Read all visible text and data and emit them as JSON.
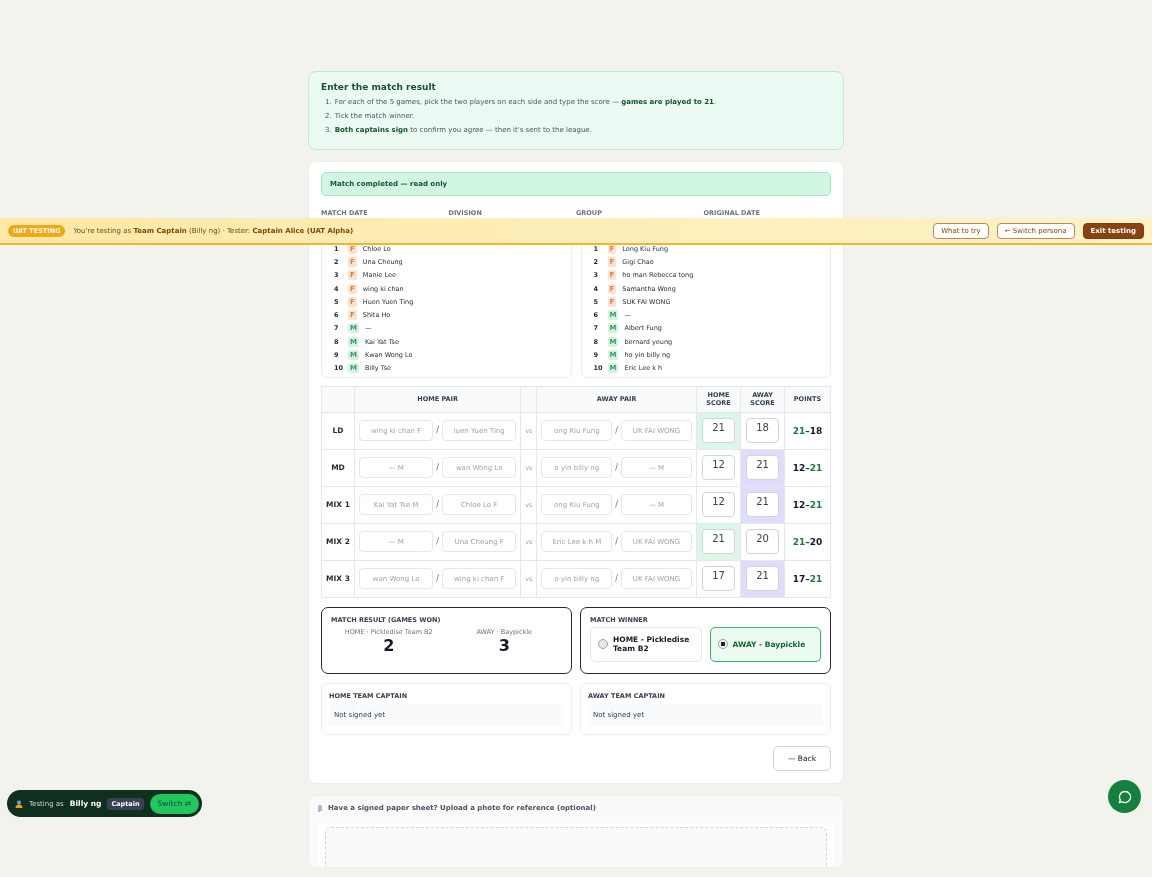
{
  "instructions": {
    "title": "Enter the match result",
    "steps": [
      "For each of the 5 games, pick the two players on each side and type the score — **games are played to 21**.",
      "Tick the match winner.",
      "**Both captains sign** to confirm you agree — then it's sent to the league."
    ],
    "step_numbers": [
      "1.",
      "2.",
      "3."
    ]
  },
  "status": "Match completed — read only",
  "meta_labels": [
    "MATCH DATE",
    "DIVISION",
    "GROUP",
    "ORIGINAL DATE"
  ],
  "testing_banner": {
    "badge": "UAT TESTING",
    "text": "You're testing as **Team Captain** (Billy ng)  · Tester: **Captain Alice (UAT Alpha)**",
    "buttons": [
      {
        "label": "What to try",
        "kind": "outline"
      },
      {
        "label": "← Switch persona",
        "kind": "outline"
      },
      {
        "label": "Exit testing",
        "kind": "solid"
      }
    ]
  },
  "rosters": [
    [
      {
        "num": "1",
        "badge": "F",
        "kind": "female",
        "name": "Chloe Lo"
      },
      {
        "num": "2",
        "badge": "F",
        "kind": "female",
        "name": "Una Cheung"
      },
      {
        "num": "3",
        "badge": "F",
        "kind": "female",
        "name": "Manie Lee"
      },
      {
        "num": "4",
        "badge": "F",
        "kind": "female",
        "name": "wing ki chan"
      },
      {
        "num": "5",
        "badge": "F",
        "kind": "female",
        "name": "Huen Yuen Ting"
      },
      {
        "num": "6",
        "badge": "F",
        "kind": "female",
        "name": "Shita Ho"
      },
      {
        "num": "7",
        "badge": "M",
        "kind": "male",
        "name": "—"
      },
      {
        "num": "8",
        "badge": "M",
        "kind": "male",
        "name": "Kai Yat Tse"
      },
      {
        "num": "9",
        "badge": "M",
        "kind": "male",
        "name": "Kwan Wong Lo"
      },
      {
        "num": "10",
        "badge": "M",
        "kind": "male",
        "name": "Billy Tse"
      }
    ],
    [
      {
        "num": "1",
        "badge": "F",
        "kind": "female",
        "name": "Long Kiu Fung"
      },
      {
        "num": "2",
        "badge": "F",
        "kind": "female",
        "name": "Gigi Chao"
      },
      {
        "num": "3",
        "badge": "F",
        "kind": "female",
        "name": "ho man Rebecca tong"
      },
      {
        "num": "4",
        "badge": "F",
        "kind": "female",
        "name": "Samantha Wong"
      },
      {
        "num": "5",
        "badge": "F",
        "kind": "female",
        "name": "SUK FAI WONG"
      },
      {
        "num": "6",
        "badge": "M",
        "kind": "male",
        "name": "—"
      },
      {
        "num": "7",
        "badge": "M",
        "kind": "male",
        "name": "Albert Fung"
      },
      {
        "num": "8",
        "badge": "M",
        "kind": "male",
        "name": "bernard yeung"
      },
      {
        "num": "9",
        "badge": "M",
        "kind": "male",
        "name": "ho yin billy ng"
      },
      {
        "num": "10",
        "badge": "M",
        "kind": "male",
        "name": "Eric Lee k h"
      }
    ]
  ],
  "games_table": {
    "columns": [
      "HOME PAIR",
      "AWAY PAIR",
      "HOME SCORE",
      "AWAY SCORE",
      "POINTS"
    ],
    "separator": "/",
    "rows": [
      {
        "game": "LD",
        "home": [
          "wing ki chan F",
          "luen Yuen Ting"
        ],
        "away": [
          "ong Kiu Fung",
          "UK FAI WONG"
        ],
        "home_score": "21",
        "away_score": "18",
        "home_won": true,
        "vs": "vs",
        "points": {
          "home": "21",
          "dash": "–",
          "away": "18"
        }
      },
      {
        "game": "MD",
        "home": [
          "— M",
          "wan Wong Lo"
        ],
        "away": [
          "o yin billy ng",
          "— M"
        ],
        "home_score": "12",
        "away_score": "21",
        "home_won": false,
        "vs": "vs",
        "points": {
          "home": "12",
          "dash": "–",
          "away": "21"
        }
      },
      {
        "game": "MIX 1",
        "home": [
          "Kai Yat Tse M",
          "Chloe Lo F"
        ],
        "away": [
          "ong Kiu Fung",
          "— M"
        ],
        "home_score": "12",
        "away_score": "21",
        "home_won": false,
        "vs": "vs",
        "points": {
          "home": "12",
          "dash": "–",
          "away": "21"
        }
      },
      {
        "game": "MIX 2",
        "home": [
          "— M",
          "Una Cheung F"
        ],
        "away": [
          "Eric Lee k h M",
          "UK FAI WONG"
        ],
        "home_score": "21",
        "away_score": "20",
        "home_won": true,
        "vs": "vs",
        "points": {
          "home": "21",
          "dash": "–",
          "away": "20"
        }
      },
      {
        "game": "MIX 3",
        "home": [
          "wan Wong Lo",
          "wing ki chan F"
        ],
        "away": [
          "o yin billy ng",
          "UK FAI WONG"
        ],
        "home_score": "17",
        "away_score": "21",
        "home_won": false,
        "vs": "vs",
        "points": {
          "home": "17",
          "dash": "–",
          "away": "21"
        }
      }
    ]
  },
  "match_result": {
    "title": "MATCH RESULT (GAMES WON)",
    "teams": [
      {
        "label": "HOME · Pickledise Team B2",
        "games": "2"
      },
      {
        "label": "AWAY · Baypickle",
        "games": "3"
      }
    ]
  },
  "match_winner": {
    "title": "MATCH WINNER",
    "options": [
      {
        "label": "HOME - Pickledise Team B2",
        "selected": false
      },
      {
        "label": "AWAY - Baypickle",
        "selected": true
      }
    ]
  },
  "captains": [
    {
      "title": "HOME TEAM CAPTAIN",
      "status": "Not signed yet"
    },
    {
      "title": "AWAY TEAM CAPTAIN",
      "status": "Not signed yet"
    }
  ],
  "back_button": "— Back",
  "upload": {
    "text": "Have a signed paper sheet? Upload a photo for reference (optional)"
  },
  "persona_pill": {
    "prefix": "Testing as",
    "name": "Billy ng",
    "role": "Captain",
    "button": "Switch ⇄"
  }
}
